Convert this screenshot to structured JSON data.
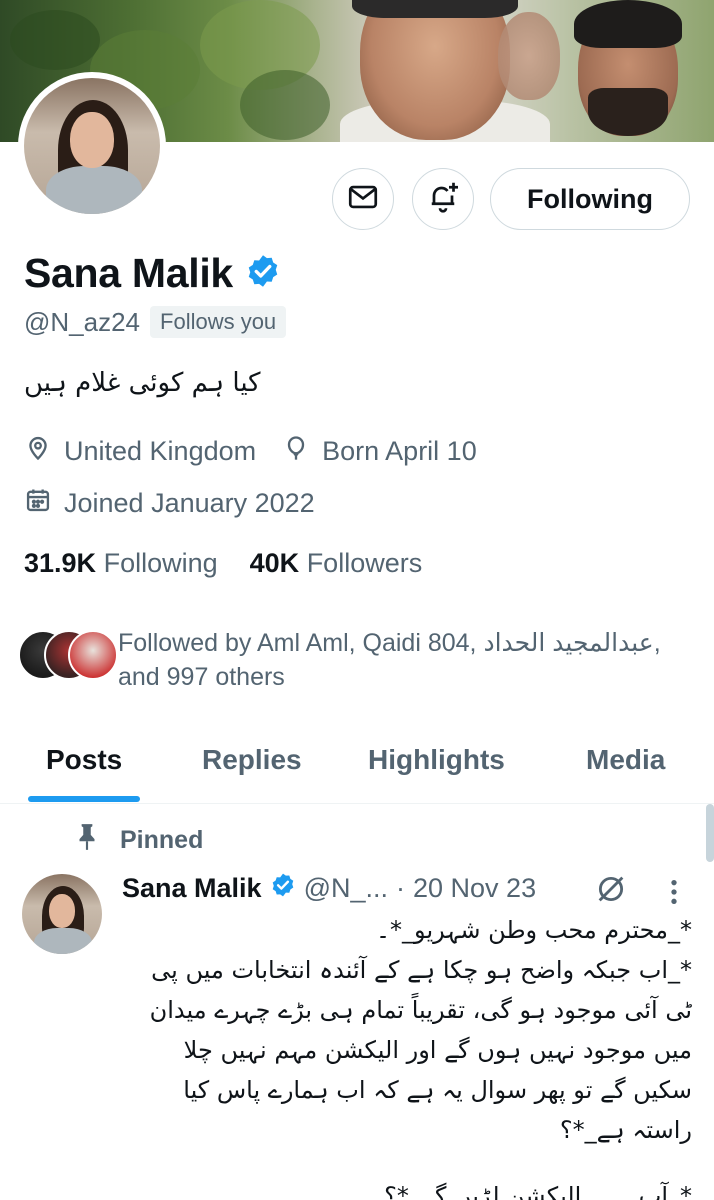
{
  "profile": {
    "name": "Sana Malik",
    "handle": "@N_az24",
    "follows_you": "Follows you",
    "bio": "کیا ہم کوئی غلام ہیں",
    "location": "United Kingdom",
    "birthday": "Born April 10",
    "joined": "Joined January 2022",
    "following_count": "31.9K",
    "following_label": "Following",
    "followers_count": "40K",
    "followers_label": "Followers",
    "followed_by": "Followed by Aml Aml, Qaidi 804, عبدالمجید الحداد, and 997 others",
    "verified_color": "#1d9bf0"
  },
  "actions": {
    "message_icon": "envelope-icon",
    "notify_icon": "bell-plus-icon",
    "follow_label": "Following"
  },
  "tabs": [
    {
      "label": "Posts",
      "active": true
    },
    {
      "label": "Replies",
      "active": false
    },
    {
      "label": "Highlights",
      "active": false
    },
    {
      "label": "Media",
      "active": false
    }
  ],
  "post": {
    "pinned_label": "Pinned",
    "author": "Sana Malik",
    "handle": "@N_...",
    "dot": "·",
    "date": "20 Nov 23",
    "lines": [
      "*_محترم محب وطن شہریو_*۔",
      "*_اب جبکہ واضح ہو چکا ہے کے آئندہ انتخابات میں پی ٹی آئی موجود ہو گی، تقریباً تمام ہی بڑے چہرے میدان میں موجود نہیں ہوں گے اور الیکشن مہم نہیں چلا سکیں گے تو پھر سوال یہ ہے کہ اب ہمارے پاس کیا راستہ ہے_*؟",
      "*_آپ ۔۔۔ الیکشن لڑیں گے_*؟"
    ]
  },
  "colors": {
    "accent": "#1d9bf0",
    "text_primary": "#0f1419",
    "text_secondary": "#536471",
    "border": "#cfd9de"
  }
}
